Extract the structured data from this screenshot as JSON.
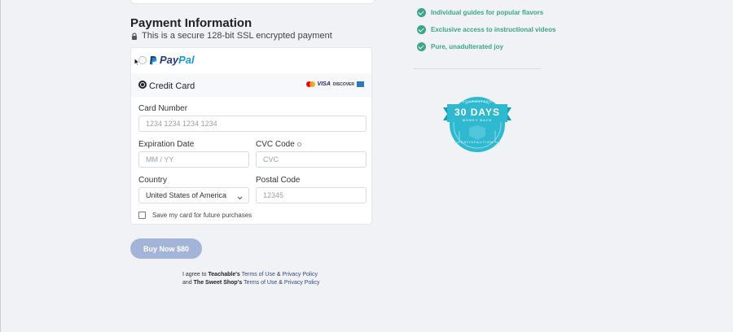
{
  "payment": {
    "title": "Payment Information",
    "secure_text": "This is a secure 128-bit SSL encrypted payment",
    "paypal": {
      "label_pay": "Pay",
      "label_pal": "Pal"
    },
    "credit_card": {
      "label": "Credit Card",
      "brands": {
        "visa": "VISA",
        "discover": "DISCOVER"
      }
    },
    "fields": {
      "card_number": {
        "label": "Card Number",
        "placeholder": "1234 1234 1234 1234"
      },
      "expiration": {
        "label": "Expiration Date",
        "placeholder": "MM / YY"
      },
      "cvc": {
        "label": "CVC Code",
        "placeholder": "CVC"
      },
      "country": {
        "label": "Country",
        "value": "United States of America"
      },
      "postal": {
        "label": "Postal Code",
        "placeholder": "12345"
      }
    },
    "save_card_label": "Save my card for future purchases"
  },
  "buy_button": "Buy Now $80",
  "legal": {
    "line1_prefix": "I agree to",
    "line1_brand": "Teachable's",
    "terms": "Terms of Use",
    "amp": "&",
    "privacy": "Privacy Policy",
    "line2_prefix": "and",
    "line2_brand": "The Sweet Shop's"
  },
  "features": [
    "Individual guides for popular flavors",
    "Exclusive access to instructional videos",
    "Pure, unadulterated joy"
  ],
  "badge": {
    "top": "GUARANTEED",
    "days": "30 DAYS",
    "money_back": "MONEY BACK",
    "satisfaction": "SATISFACTION"
  },
  "colors": {
    "accent_green": "#3aa58a",
    "buy_button": "#a3b4d8",
    "badge_teal": "#2fb9d0",
    "link": "#2f4a86"
  }
}
